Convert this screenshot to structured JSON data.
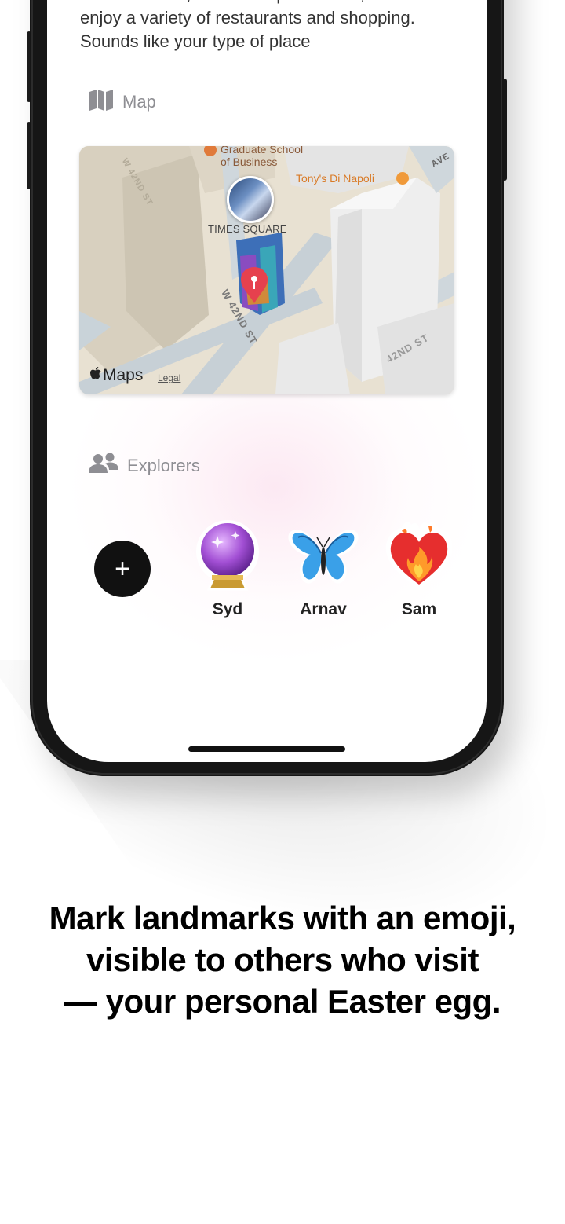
{
  "description": {
    "text": "live TV shows, see street performers, and\nenjoy a variety of restaurants and shopping.\nSounds like your type of place"
  },
  "map_section": {
    "title": "Map",
    "icon": "map-icon",
    "labels": {
      "school": "Graduate School\nof Business",
      "restaurant": "Tony's Di Napoli",
      "landmark": "TIMES SQUARE",
      "street": "W 42ND ST",
      "street_right": "42ND ST",
      "street_top_left": "W 42ND ST",
      "avenue": "AVE"
    },
    "brand": "Maps",
    "legal": "Legal"
  },
  "explorers_section": {
    "title": "Explorers",
    "icon": "people-icon",
    "add_label": "+",
    "explorers": [
      {
        "name": "Syd",
        "emoji": "crystal-ball"
      },
      {
        "name": "Arnav",
        "emoji": "butterfly"
      },
      {
        "name": "Sam",
        "emoji": "heart-on-fire"
      }
    ]
  },
  "caption": {
    "line1": "Mark landmarks with an emoji,",
    "line2": "visible to others who visit",
    "line3": "— your personal Easter egg."
  },
  "colors": {
    "accent_pin": "#e6414e",
    "text_muted": "#8e8e93",
    "phone_frame": "#161616"
  }
}
